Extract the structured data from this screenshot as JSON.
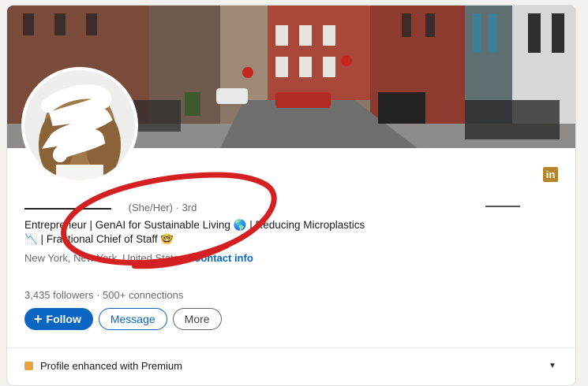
{
  "profile": {
    "pronouns": "(She/Her)",
    "degree": "· 3rd",
    "headline_line1": "Entrepreneur | GenAI for Sustainable Living 🌎 | Reducing Microplastics",
    "headline_line2": "📉 | Fractional Chief of Staff 🤓",
    "location": "New York, New York, United States",
    "location_sep": "·",
    "contact_info": "Contact info",
    "followers": "3,435 followers",
    "stats_sep": "·",
    "connections": "500+ connections"
  },
  "actions": {
    "follow": "Follow",
    "message": "Message",
    "more": "More"
  },
  "premium": {
    "label": "Profile enhanced with Premium"
  },
  "badge": {
    "text": "in"
  },
  "colors": {
    "accent": "#0a66c2",
    "annotation": "#d42020",
    "badge": "#b5852a"
  }
}
